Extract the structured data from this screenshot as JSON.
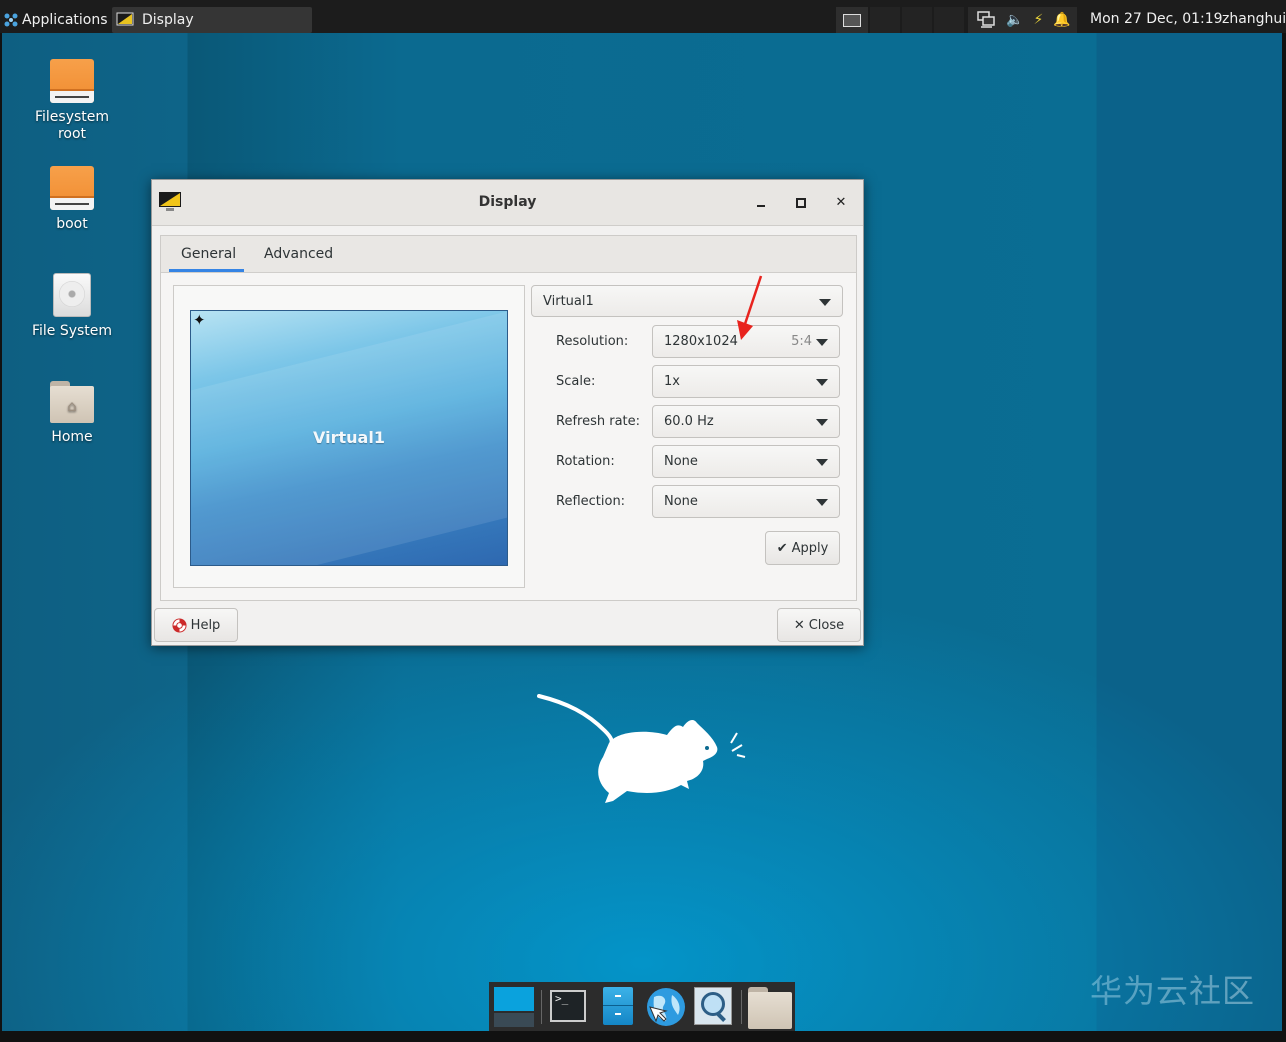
{
  "panel": {
    "applications_label": "Applications",
    "task_title": "Display",
    "clock": "Mon 27 Dec, 01:19",
    "user": "zhanghui",
    "icons": [
      "applications-icon",
      "display-app-icon",
      "workspace-icon",
      "network-icon",
      "volume-icon",
      "power-icon",
      "notifications-icon"
    ]
  },
  "desktop_icons": [
    {
      "label_line1": "Filesystem",
      "label_line2": "root",
      "icon": "drive-icon"
    },
    {
      "label_line1": "boot",
      "label_line2": "",
      "icon": "drive-icon"
    },
    {
      "label_line1": "File System",
      "label_line2": "",
      "icon": "harddisk-icon"
    },
    {
      "label_line1": "Home",
      "label_line2": "",
      "icon": "home-folder-icon"
    }
  ],
  "dialog": {
    "title": "Display",
    "tabs": [
      "General",
      "Advanced"
    ],
    "active_tab": "General",
    "preview_label": "Virtual1",
    "output_select": "Virtual1",
    "fields": {
      "resolution": {
        "label": "Resolution:",
        "value": "1280x1024",
        "aspect": "5:4"
      },
      "scale": {
        "label": "Scale:",
        "value": "1x"
      },
      "refresh": {
        "label": "Refresh rate:",
        "value": "60.0 Hz"
      },
      "rotation": {
        "label": "Rotation:",
        "value": "None"
      },
      "reflection": {
        "label": "Reflection:",
        "value": "None"
      }
    },
    "apply_label": "Apply",
    "help_label": "Help",
    "close_label": "Close"
  },
  "dock": {
    "items": [
      "show-desktop-icon",
      "terminal-icon",
      "file-manager-icon",
      "web-browser-icon",
      "app-finder-icon",
      "folder-icon"
    ]
  },
  "watermark": "华为云社区",
  "colors": {
    "accent": "#3584e4",
    "annotation_arrow": "#e8231e",
    "panel_bg": "#1c1c1c",
    "drive_orange": "#f08c30"
  }
}
